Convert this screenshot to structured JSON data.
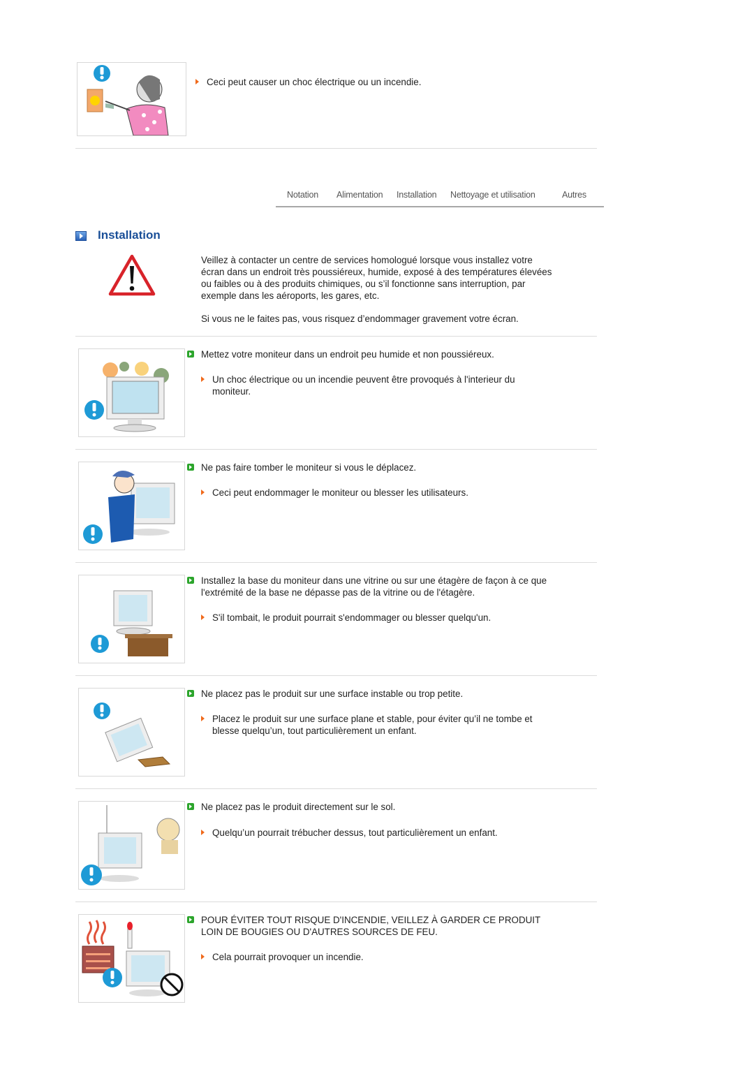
{
  "top_item": {
    "illustration": "woman-pulling-plug-illustration",
    "note": "Ceci peut causer un choc électrique ou un incendie."
  },
  "nav": {
    "items": [
      {
        "label": "Notation"
      },
      {
        "label": "Alimentation"
      },
      {
        "label": "Installation"
      },
      {
        "label": "Nettoyage et utilisation"
      },
      {
        "label": "Autres"
      }
    ]
  },
  "section": {
    "icon": "blue-arrow-box-icon",
    "title": "Installation",
    "warning_icon": "warning-triangle-icon",
    "intro": "Veillez à contacter un centre de services homologué lorsque vous installez votre écran dans un endroit très poussiéreux, humide, exposé à des températures élevées ou faibles ou à des produits chimiques, ou s’il fonctionne sans interruption, par exemple dans les aéroports, les gares, etc.",
    "intro_line1": "Veillez à contacter un centre de services homologué lorsque vous installez votre",
    "intro_line2": "écran dans un endroit très poussiéreux, humide, exposé à des températures élevées",
    "intro_line3": "ou faibles ou à des produits chimiques, ou s’il fonctionne sans interruption, par",
    "intro_line4": "exemple dans les aéroports, les gares, etc.",
    "consequence": "Si vous ne le faites pas, vous risquez d’endommager gravement votre écran."
  },
  "items": [
    {
      "illustration": "monitor-dust-humidity-illustration",
      "main": [
        "Mettez votre moniteur dans un endroit peu humide et non poussiéreux."
      ],
      "sub": [
        "Un choc électrique ou un incendie peuvent être provoqués à l'interieur du",
        "moniteur."
      ]
    },
    {
      "illustration": "man-carrying-monitor-illustration",
      "main": [
        "Ne pas faire tomber le moniteur si vous le déplacez."
      ],
      "sub": [
        "Ceci peut endommager le moniteur ou blesser les utilisateurs."
      ]
    },
    {
      "illustration": "monitor-on-shelf-edge-illustration",
      "main": [
        "Installez la base du moniteur dans une vitrine ou sur une étagère de façon à ce que",
        "l'extrémité de la base ne dépasse pas de la vitrine ou de l'étagère."
      ],
      "sub": [
        "S'il tombait, le produit pourrait s'endommager ou blesser quelqu'un."
      ]
    },
    {
      "illustration": "monitor-tipping-illustration",
      "main": [
        "Ne placez pas le produit sur une surface instable ou trop petite."
      ],
      "sub": [
        "Placez le produit sur une surface plane et stable, pour éviter qu’il ne tombe et",
        "blesse quelqu’un, tout particulièrement un enfant."
      ]
    },
    {
      "illustration": "monitor-on-floor-child-illustration",
      "main": [
        "Ne placez pas le produit directement sur le sol."
      ],
      "sub": [
        "Quelqu’un pourrait trébucher dessus, tout particulièrement un enfant."
      ]
    },
    {
      "illustration": "monitor-near-candle-heater-illustration",
      "main": [
        "POUR ÉVITER TOUT RISQUE D'INCENDIE, VEILLEZ À GARDER CE PRODUIT",
        "LOIN DE BOUGIES OU D'AUTRES SOURCES DE FEU."
      ],
      "sub": [
        "Cela pourrait provoquer un incendie."
      ]
    }
  ]
}
